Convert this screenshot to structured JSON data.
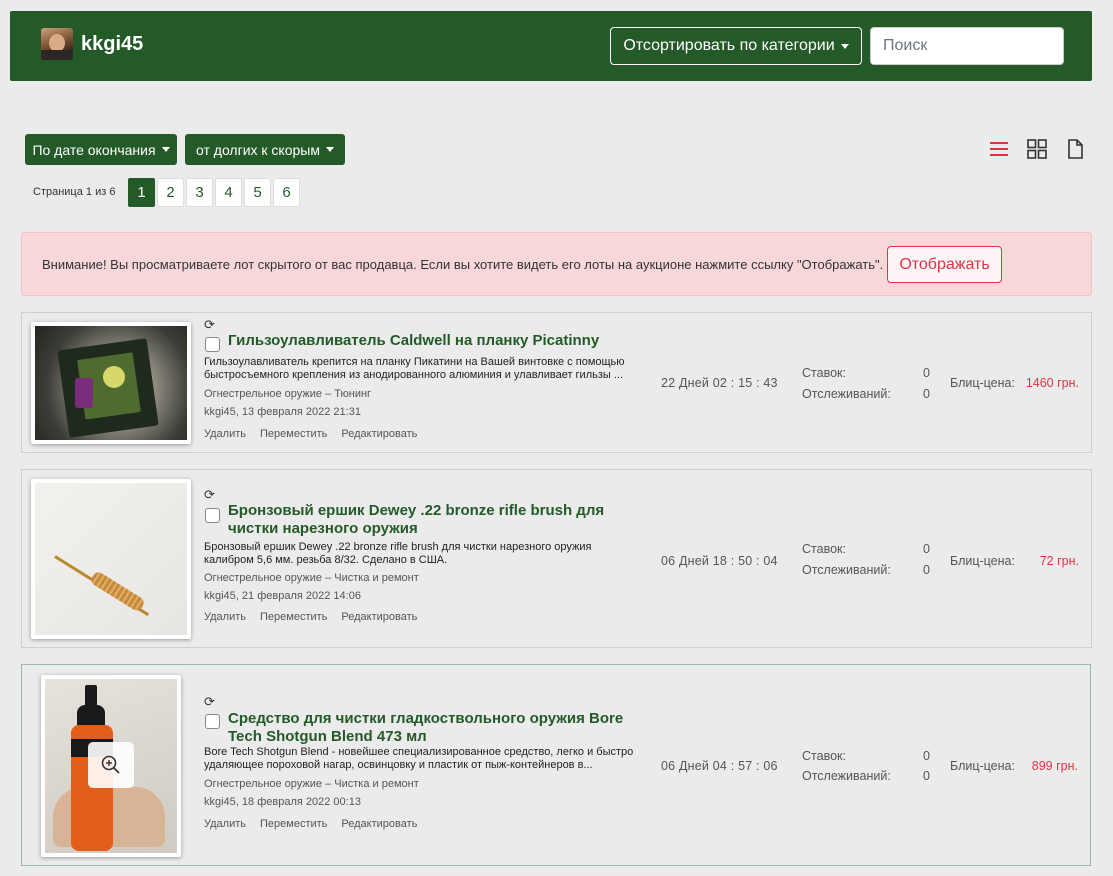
{
  "header": {
    "username": "kkgi45",
    "sort_category_label": "Отсортировать по категории",
    "search_placeholder": "Поиск"
  },
  "toolbar": {
    "sort_field_label": "По дате окончания",
    "sort_order_label": "от долгих к скорым",
    "views": [
      "list-icon",
      "grid-icon",
      "document-icon"
    ],
    "active_view_color": "#dc3545"
  },
  "pagination": {
    "info": "Страница 1 из 6",
    "pages": [
      "1",
      "2",
      "3",
      "4",
      "5",
      "6"
    ],
    "current": "1"
  },
  "alert": {
    "text": "Внимание! Вы просматриваете лот скрытого от вас продавца. Если вы хотите видеть его лоты на аукционе нажмите ссылку \"Отображать\".",
    "button": "Отображать"
  },
  "labels": {
    "bids": "Ставок:",
    "watchers": "Отслеживаний:",
    "blitz": "Блиц-цена:",
    "delete": "Удалить",
    "move": "Переместить",
    "edit": "Редактировать"
  },
  "lots": [
    {
      "title_lines": [
        "Гильзоулавливатель Caldwell на планку Picatinny"
      ],
      "desc_lines": [
        "Гильзоулавливатель крепится на планку Пикатини на Вашей винтовке с помощью",
        "быстросъемного крепления из анодированного алюминия и улавливает гильзы ..."
      ],
      "category": "Огнестрельное оружие",
      "subcategory": "Тюнинг",
      "author_date": "kkgi45, 13 февраля 2022 21:31",
      "timer": "22 Дней 02 : 15 : 43",
      "bids": "0",
      "watchers": "0",
      "price": "1460 грн."
    },
    {
      "title_lines": [
        "Бронзовый ершик Dewey .22 bronze rifle brush для",
        "чистки нарезного оружия"
      ],
      "desc_lines": [
        "Бронзовый ершик Dewey .22 bronze rifle brush для чистки нарезного оружия",
        "калибром 5,6 мм. резьба 8/32. Сделано в США."
      ],
      "category": "Огнестрельное оружие",
      "subcategory": "Чистка и ремонт",
      "author_date": "kkgi45, 21 февраля 2022 14:06",
      "timer": "06 Дней 18 : 50 : 04",
      "bids": "0",
      "watchers": "0",
      "price": "72 грн."
    },
    {
      "title_lines": [
        "Средство для чистки гладкоствольного оружия Bore",
        "Tech Shotgun Blend 473 мл"
      ],
      "desc_lines": [
        "Bore Tech Shotgun Blend - новейшее специализированное средство, легко и быстро",
        "удаляющее пороховой нагар, освинцовку и пластик от пыж-контейнеров в..."
      ],
      "category": "Огнестрельное оружие",
      "subcategory": "Чистка и ремонт",
      "author_date": "kkgi45, 18 февраля 2022 00:13",
      "timer": "06 Дней 04 : 57 : 06",
      "bids": "0",
      "watchers": "0",
      "price": "899 грн."
    }
  ]
}
